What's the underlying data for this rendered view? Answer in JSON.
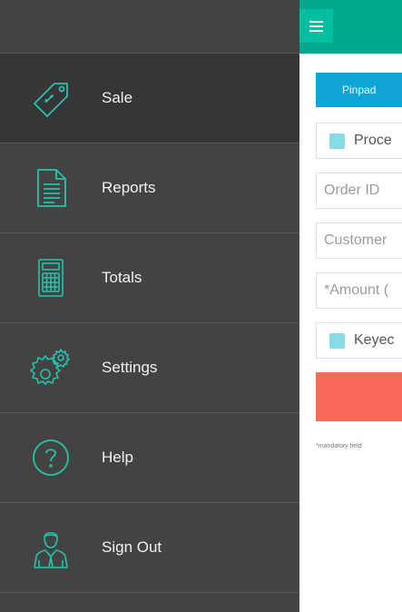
{
  "sidebar": {
    "items": [
      {
        "label": "Sale",
        "icon": "price-tag-icon",
        "active": true
      },
      {
        "label": "Reports",
        "icon": "document-icon"
      },
      {
        "label": "Totals",
        "icon": "calculator-icon"
      },
      {
        "label": "Settings",
        "icon": "gears-icon"
      },
      {
        "label": "Help",
        "icon": "question-circle-icon"
      },
      {
        "label": "Sign Out",
        "icon": "user-icon"
      }
    ]
  },
  "topbar": {
    "menu_icon": "hamburger-icon"
  },
  "form": {
    "pinpad_label": "Pinpad",
    "process_label": "Proce",
    "order_id_placeholder": "Order ID",
    "customer_placeholder": "Customer",
    "amount_placeholder": "*Amount (",
    "keyed_label": "Keyec",
    "mandatory_note": "*mandatory field"
  },
  "colors": {
    "sidebar_bg": "#434343",
    "sidebar_active": "#363636",
    "accent_teal": "#00a98d",
    "icon_teal": "#25c4aa",
    "pinpad_blue": "#0fa5d6",
    "submit_red": "#fb6a57",
    "checkbox": "#85dce5"
  }
}
